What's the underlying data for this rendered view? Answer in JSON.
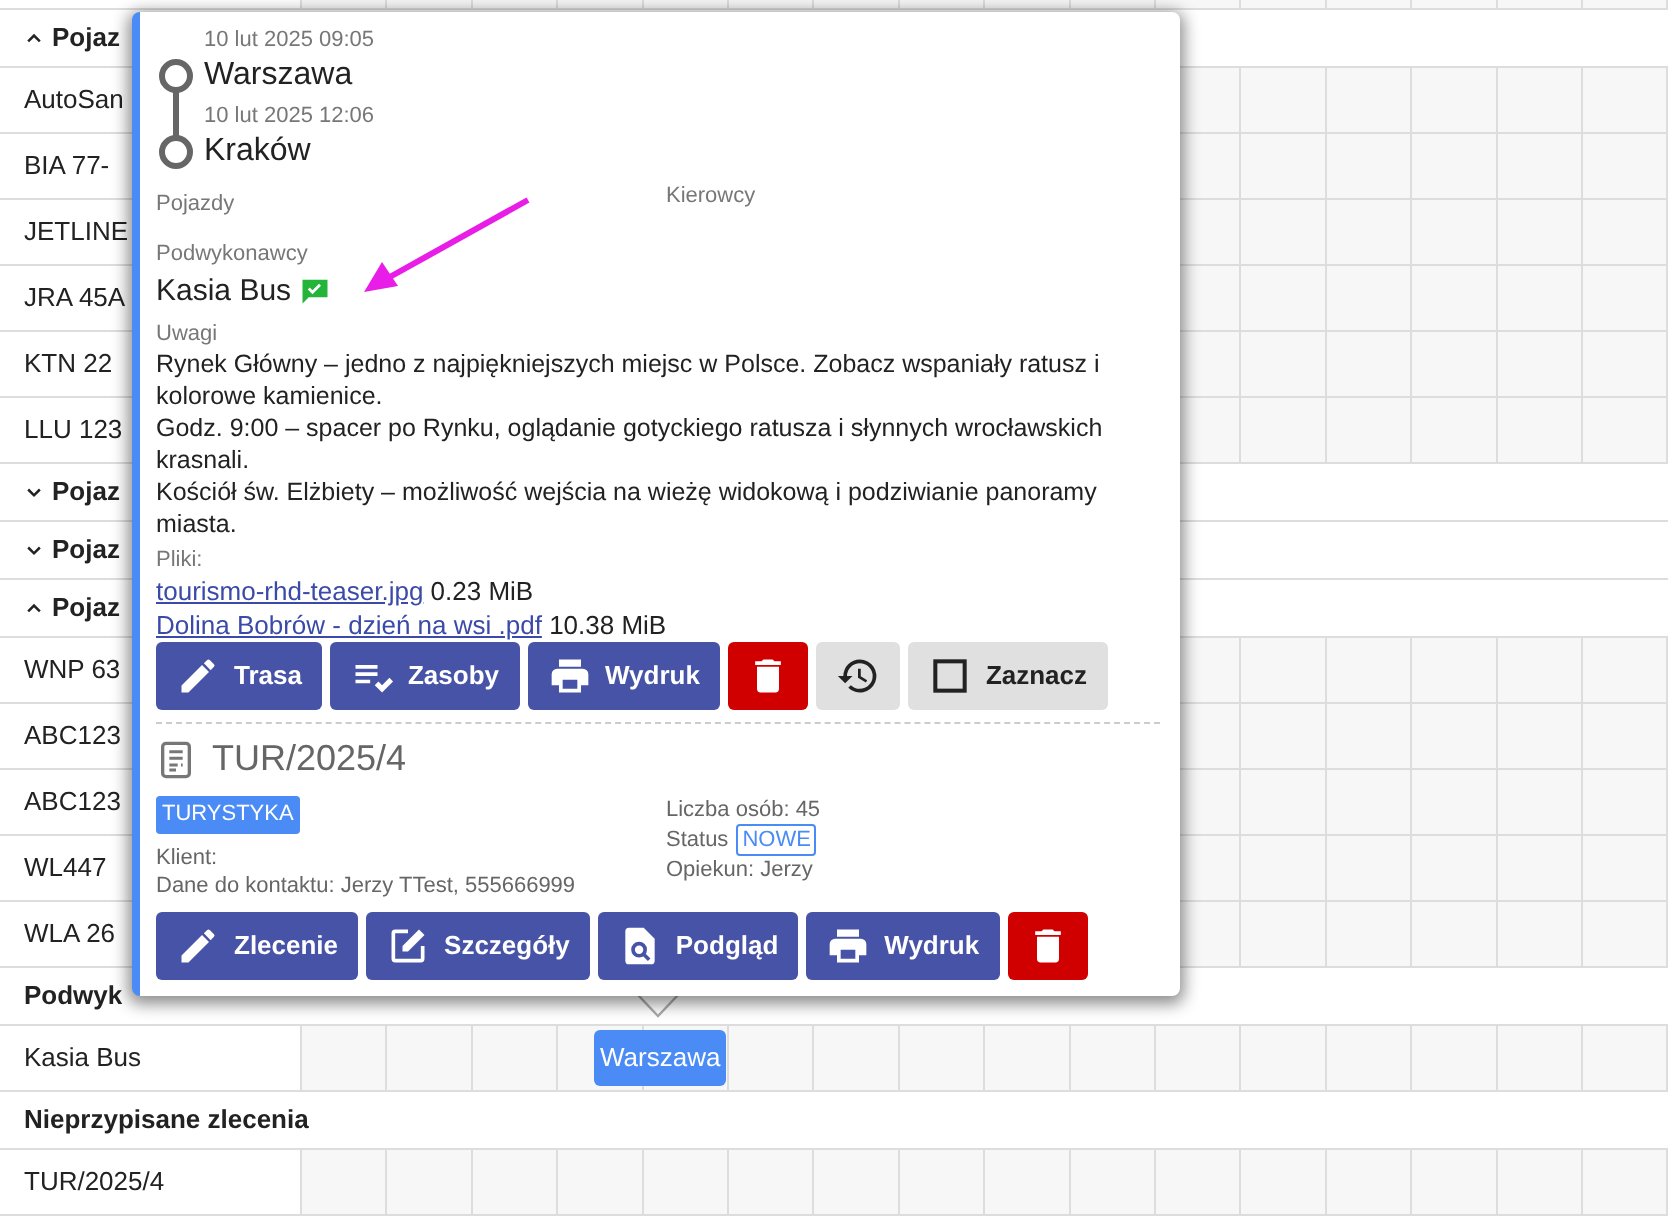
{
  "schedule": {
    "rows": [
      {
        "kind": "group",
        "label": "Pojaz",
        "expanded": true
      },
      {
        "kind": "resource",
        "label": "AutoSan"
      },
      {
        "kind": "resource",
        "label": "BIA 77-"
      },
      {
        "kind": "resource",
        "label": "JETLINE"
      },
      {
        "kind": "resource",
        "label": "JRA 45A"
      },
      {
        "kind": "resource",
        "label": "KTN 22"
      },
      {
        "kind": "resource",
        "label": "LLU 123"
      },
      {
        "kind": "group",
        "label": "Pojaz",
        "expanded": false
      },
      {
        "kind": "group",
        "label": "Pojaz",
        "expanded": false
      },
      {
        "kind": "group",
        "label": "Pojaz",
        "expanded": true
      },
      {
        "kind": "resource",
        "label": "WNP 63"
      },
      {
        "kind": "resource",
        "label": "ABC123"
      },
      {
        "kind": "resource",
        "label": "ABC123"
      },
      {
        "kind": "resource",
        "label": "WL447"
      },
      {
        "kind": "resource",
        "label": "WLA 26"
      },
      {
        "kind": "section",
        "label": "Podwyk"
      },
      {
        "kind": "resource",
        "label": "Kasia Bus",
        "event": {
          "label": "Warszawa"
        }
      },
      {
        "kind": "section",
        "label": "Nieprzypisane zlecenia"
      },
      {
        "kind": "resource",
        "label": "TUR/2025/4"
      }
    ]
  },
  "popover": {
    "stops": [
      {
        "time": "10 lut 2025 09:05",
        "place": "Warszawa"
      },
      {
        "time": "10 lut 2025 12:06",
        "place": "Kraków"
      }
    ],
    "vehicles_label": "Pojazdy",
    "drivers_label": "Kierowcy",
    "subcontractors_label": "Podwykonawcy",
    "subcontractor": {
      "name": "Kasia Bus",
      "confirmed": true
    },
    "notes_label": "Uwagi",
    "notes": [
      "Rynek Główny – jedno z najpiękniejszych miejsc w Polsce. Zobacz wspaniały ratusz i kolorowe kamienice.",
      "Godz. 9:00 – spacer po Rynku, oglądanie gotyckiego ratusza i słynnych wrocławskich krasnali.",
      "Kościół św. Elżbiety – możliwość wejścia na wieżę widokową i podziwianie panoramy miasta."
    ],
    "files_label": "Pliki:",
    "files": [
      {
        "name": "tourismo-rhd-teaser.jpg",
        "size": "0.23 MiB"
      },
      {
        "name": "Dolina Bobrów - dzień na wsi .pdf",
        "size": "10.38 MiB"
      }
    ],
    "actions": [
      {
        "kind": "edit",
        "label": "Trasa"
      },
      {
        "kind": "resources",
        "label": "Zasoby"
      },
      {
        "kind": "print",
        "label": "Wydruk"
      },
      {
        "kind": "delete"
      },
      {
        "kind": "history"
      },
      {
        "kind": "select",
        "label": "Zaznacz",
        "checked": false
      }
    ],
    "order": {
      "number": "TUR/2025/4",
      "category": "TURYSTYKA",
      "client_label": "Klient:",
      "contact": "Dane do kontaktu: Jerzy TTest, 555666999",
      "people": "Liczba osób: 45",
      "status_label": "Status",
      "status": "NOWE",
      "manager": "Opiekun: Jerzy",
      "actions": [
        {
          "kind": "edit",
          "label": "Zlecenie"
        },
        {
          "kind": "details",
          "label": "Szczegóły"
        },
        {
          "kind": "preview",
          "label": "Podgląd"
        },
        {
          "kind": "print",
          "label": "Wydruk"
        },
        {
          "kind": "delete"
        }
      ]
    }
  }
}
